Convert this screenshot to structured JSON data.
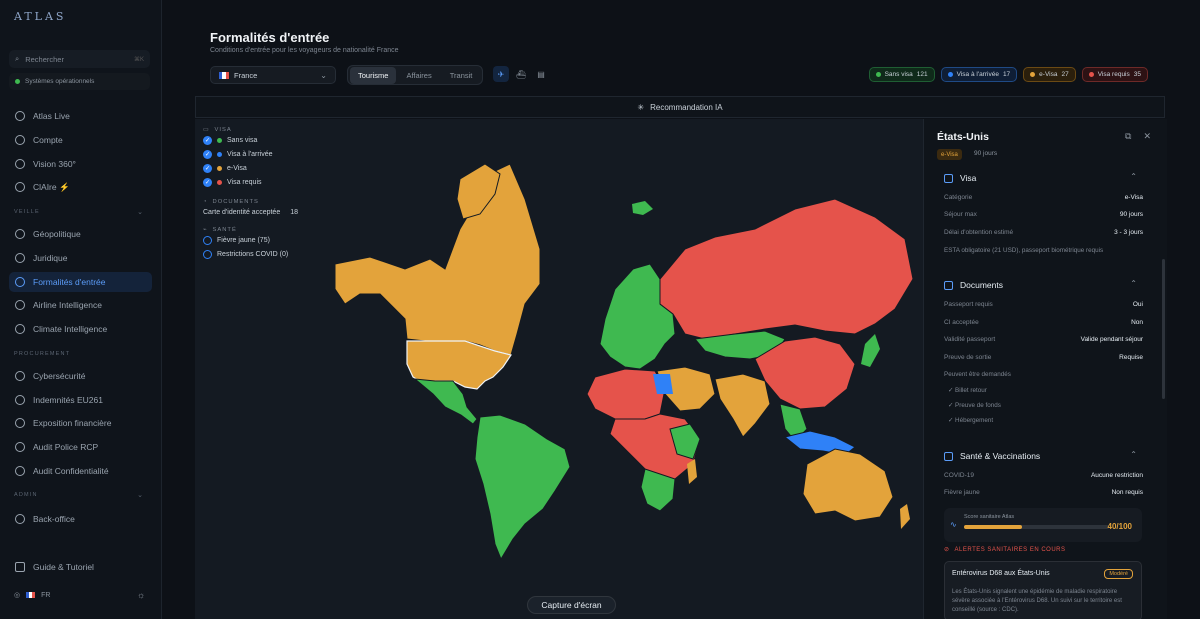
{
  "sidebar": {
    "logo": "ATLAS",
    "search_placeholder": "Rechercher",
    "search_shortcut": "⌘K",
    "status": "Systèmes opérationnels",
    "items_top": [
      {
        "label": "Atlas Live",
        "icon": "eye-icon"
      },
      {
        "label": "Compte",
        "icon": "user-icon"
      },
      {
        "label": "Vision 360°",
        "icon": "target-icon"
      },
      {
        "label": "ClAIre ⚡",
        "icon": "sparkle-icon"
      }
    ],
    "section_veille": "VEILLE",
    "items_veille": [
      {
        "label": "Géopolitique",
        "icon": "globe-icon"
      },
      {
        "label": "Juridique",
        "icon": "scale-icon"
      },
      {
        "label": "Formalités d'entrée",
        "icon": "plane-icon",
        "active": true
      },
      {
        "label": "Airline Intelligence",
        "icon": "airline-icon"
      },
      {
        "label": "Climate Intelligence",
        "icon": "cloud-icon"
      }
    ],
    "section_proc": "PROCUREMENT",
    "items_proc": [
      {
        "label": "Cybersécurité",
        "icon": "shield-icon"
      },
      {
        "label": "Indemnités EU261",
        "icon": "euro-icon"
      },
      {
        "label": "Exposition financière",
        "icon": "chart-icon"
      },
      {
        "label": "Audit Police RCP",
        "icon": "shield-check-icon"
      },
      {
        "label": "Audit Confidentialité",
        "icon": "document-icon"
      }
    ],
    "section_admin": "ADMIN",
    "items_admin": [
      {
        "label": "Back-office",
        "icon": "users-icon"
      }
    ],
    "guide": "Guide & Tutoriel",
    "lang": "FR"
  },
  "header": {
    "title": "Formalités d'entrée",
    "subtitle": "Conditions d'entrée pour les voyageurs de nationalité France",
    "country": "France",
    "tabs": [
      "Tourisme",
      "Affaires",
      "Transit"
    ],
    "chips": [
      {
        "label": "Sans visa",
        "count": "121",
        "color": "#3fb950"
      },
      {
        "label": "Visa à l'arrivée",
        "count": "17",
        "color": "#2f81f7"
      },
      {
        "label": "e-Visa",
        "count": "27",
        "color": "#e3a33b"
      },
      {
        "label": "Visa requis",
        "count": "35",
        "color": "#e5534b"
      }
    ],
    "banner": "Recommandation IA"
  },
  "legend": {
    "visa_title": "VISA",
    "visa_items": [
      {
        "label": "Sans visa",
        "color": "#3fb950"
      },
      {
        "label": "Visa à l'arrivée",
        "color": "#2f81f7"
      },
      {
        "label": "e-Visa",
        "color": "#e3a33b"
      },
      {
        "label": "Visa requis",
        "color": "#e5534b"
      }
    ],
    "docs_title": "DOCUMENTS",
    "docs_item": "Carte d'identité acceptée",
    "docs_count": "18",
    "health_title": "SANTÉ",
    "health_items": [
      "Fièvre jaune (75)",
      "Restrictions COVID (0)"
    ]
  },
  "capture": "Capture d'écran",
  "panel": {
    "country": "États-Unis",
    "badge": "e-Visa",
    "days": "90 jours",
    "visa_title": "Visa",
    "visa_rows": [
      {
        "k": "Catégorie",
        "v": "e-Visa"
      },
      {
        "k": "Séjour max",
        "v": "90 jours"
      },
      {
        "k": "Délai d'obtention estimé",
        "v": "3 - 3 jours"
      }
    ],
    "visa_note": "ESTA obligatoire (21 USD), passeport biométrique requis",
    "docs_title": "Documents",
    "docs_rows": [
      {
        "k": "Passeport requis",
        "v": "Oui"
      },
      {
        "k": "CI acceptée",
        "v": "Non"
      },
      {
        "k": "Validité passeport",
        "v": "Valide pendant séjour"
      },
      {
        "k": "Preuve de sortie",
        "v": "Requise"
      }
    ],
    "docs_note": "Peuvent être demandés",
    "docs_list": [
      "Billet retour",
      "Preuve de fonds",
      "Hébergement"
    ],
    "health_title": "Santé & Vaccinations",
    "health_rows": [
      {
        "k": "COVID-19",
        "v": "Aucune restriction"
      },
      {
        "k": "Fièvre jaune",
        "v": "Non requis"
      }
    ],
    "score_label": "Score sanitaire Atlas",
    "score_value": "40/100",
    "score_fraction": 0.4,
    "alerts_title": "ALERTES SANITAIRES EN COURS",
    "alert_title": "Entérovirus D68 aux États-Unis",
    "alert_badge": "Modéré",
    "alert_text": "Les États-Unis signalent une épidémie de maladie respiratoire sévère associée à l'Entérovirus D68. Un suivi sur le territoire est conseillé (source : CDC)."
  }
}
